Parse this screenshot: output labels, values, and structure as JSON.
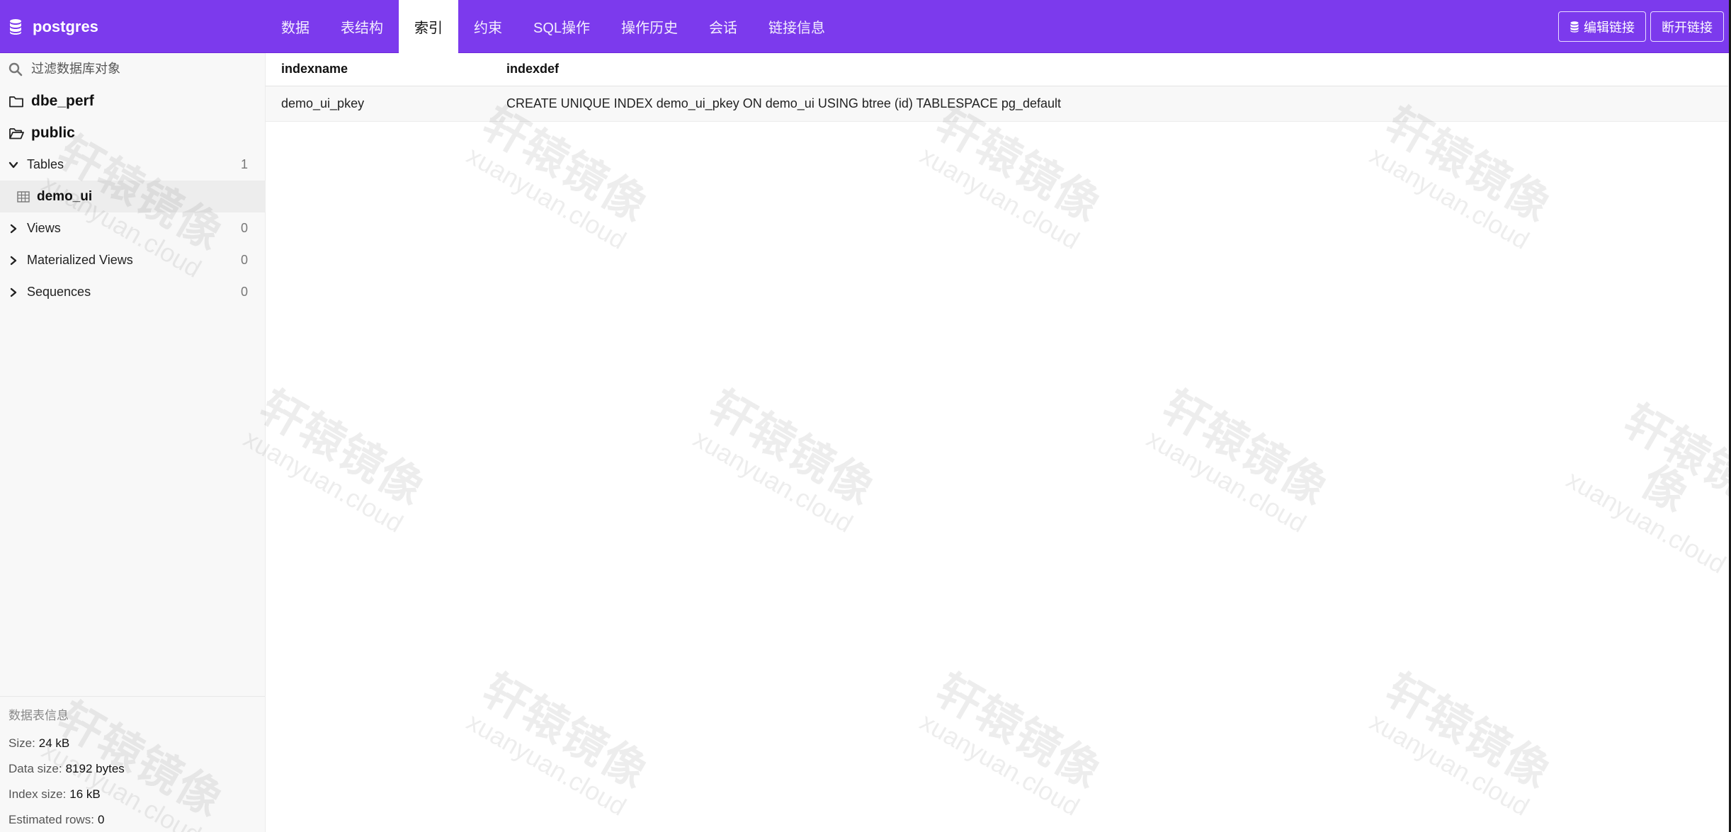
{
  "app": {
    "database_name": "postgres"
  },
  "tabs": [
    {
      "label": "数据",
      "active": false
    },
    {
      "label": "表结构",
      "active": false
    },
    {
      "label": "索引",
      "active": true
    },
    {
      "label": "约束",
      "active": false
    },
    {
      "label": "SQL操作",
      "active": false
    },
    {
      "label": "操作历史",
      "active": false
    },
    {
      "label": "会话",
      "active": false
    },
    {
      "label": "链接信息",
      "active": false
    }
  ],
  "actions": {
    "edit_label": "编辑链接",
    "disconnect_label": "断开链接"
  },
  "sidebar": {
    "search_placeholder": "过滤数据库对象",
    "schemas": [
      {
        "name": "dbe_perf",
        "expanded": false,
        "icon": "folder-icon"
      },
      {
        "name": "public",
        "expanded": true,
        "icon": "folder-open-icon"
      }
    ],
    "sections": {
      "tables": {
        "label": "Tables",
        "count": "1",
        "expanded": true,
        "items": [
          "demo_ui"
        ]
      },
      "views": {
        "label": "Views",
        "count": "0"
      },
      "matviews": {
        "label": "Materialized Views",
        "count": "0"
      },
      "sequences": {
        "label": "Sequences",
        "count": "0"
      }
    },
    "info": {
      "title": "数据表信息",
      "size_label": "Size:",
      "size_value": "24 kB",
      "data_size_label": "Data size:",
      "data_size_value": "8192 bytes",
      "index_size_label": "Index size:",
      "index_size_value": "16 kB",
      "rows_label": "Estimated rows:",
      "rows_value": "0"
    }
  },
  "index_table": {
    "columns": [
      "indexname",
      "indexdef"
    ],
    "rows": [
      [
        "demo_ui_pkey",
        "CREATE UNIQUE INDEX demo_ui_pkey ON demo_ui USING btree (id) TABLESPACE pg_default"
      ]
    ]
  },
  "watermark": {
    "cn": "轩辕镜像",
    "en": "xuanyuan.cloud"
  },
  "colors": {
    "accent": "#7c3aed",
    "sidebar_bg": "#f8f8f8"
  }
}
